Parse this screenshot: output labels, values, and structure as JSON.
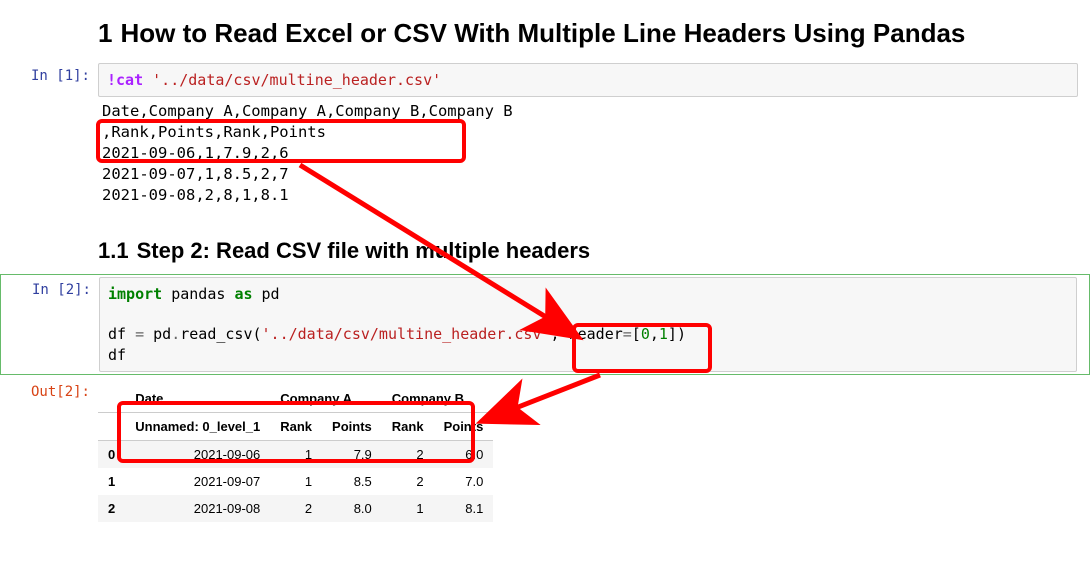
{
  "headings": {
    "h1_num": "1",
    "h1_text": "How to Read Excel or CSV With Multiple Line Headers Using Pandas",
    "h2_num": "1.1",
    "h2_text": "Step 2: Read CSV file with multiple headers"
  },
  "prompts": {
    "in1": "In [1]:",
    "in2": "In [2]:",
    "out2": "Out[2]:"
  },
  "cell1": {
    "bang": "!cat ",
    "path": "'../data/csv/multine_header.csv'",
    "out_lines": [
      "Date,Company A,Company A,Company B,Company B",
      ",Rank,Points,Rank,Points",
      "2021-09-06,1,7.9,2,6",
      "2021-09-07,1,8.5,2,7",
      "2021-09-08,2,8,1,8.1"
    ]
  },
  "cell2": {
    "kw_import": "import",
    "mod": " pandas ",
    "kw_as": "as",
    "alias": " pd",
    "line2a": "df ",
    "eq": "=",
    "line2b": " pd",
    "dot": ".",
    "fn": "read_csv(",
    "arg_str": "'../data/csv/multine_header.csv'",
    "comma": ", ",
    "kw_header": "header",
    "eq2": "=",
    "br_open": "[",
    "n0": "0",
    "c": ",",
    "n1": "1",
    "br_close": "])",
    "line3": "df"
  },
  "df": {
    "top": [
      "Date",
      "Company A",
      "Company B"
    ],
    "sub": [
      "Unnamed: 0_level_1",
      "Rank",
      "Points",
      "Rank",
      "Points"
    ],
    "rows": [
      {
        "i": "0",
        "date": "2021-09-06",
        "a_rank": "1",
        "a_pts": "7.9",
        "b_rank": "2",
        "b_pts": "6.0"
      },
      {
        "i": "1",
        "date": "2021-09-07",
        "a_rank": "1",
        "a_pts": "8.5",
        "b_rank": "2",
        "b_pts": "7.0"
      },
      {
        "i": "2",
        "date": "2021-09-08",
        "a_rank": "2",
        "a_pts": "8.0",
        "b_rank": "1",
        "b_pts": "8.1"
      }
    ]
  }
}
